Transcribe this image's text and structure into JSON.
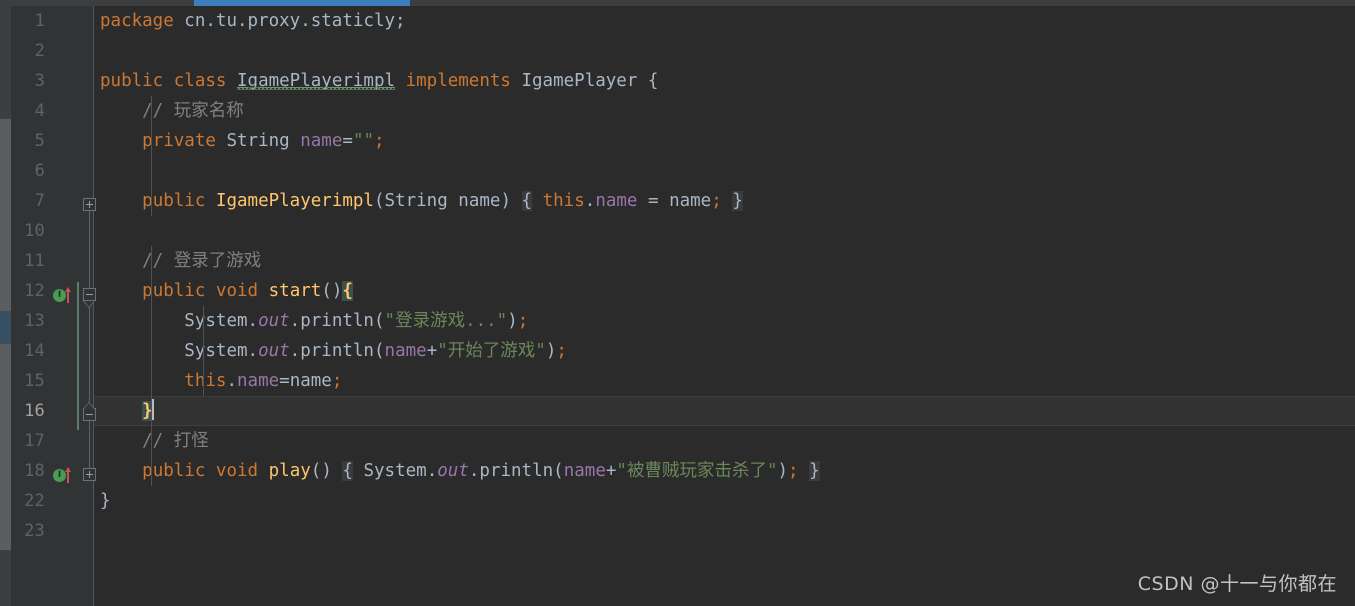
{
  "window": {
    "theme": "darcula",
    "editor_background": "#2b2b2b",
    "gutter_background": "#313335",
    "accent_blue": "#3c7ebd",
    "caret_line_background": "#323232"
  },
  "top_strip": {
    "name": "tab-underline",
    "color": "#3c7ebd"
  },
  "scrollbar": {
    "name": "left-scrollbar",
    "thumb_color": "#5b5d5e",
    "marker_color": "#375063"
  },
  "gutter": {
    "line_numbers": [
      "1",
      "2",
      "3",
      "4",
      "5",
      "6",
      "7",
      "10",
      "11",
      "12",
      "13",
      "14",
      "15",
      "16",
      "17",
      "18",
      "22",
      "23"
    ],
    "caret_line_number": "16",
    "implements_marker_label": "I",
    "markers": [
      {
        "line": "12",
        "type": "implements-method",
        "icon": "green-circle-i-icon",
        "arrow": "red-up-arrow-icon"
      },
      {
        "line": "18",
        "type": "implements-method",
        "icon": "green-circle-i-icon",
        "arrow": "red-up-arrow-icon"
      }
    ],
    "fold_markers": [
      {
        "line": "7",
        "state": "collapsed",
        "glyph": "plus"
      },
      {
        "line": "12",
        "state": "expanded-start",
        "glyph": "minus"
      },
      {
        "line": "16",
        "state": "expanded-end",
        "glyph": "minus"
      },
      {
        "line": "18",
        "state": "collapsed",
        "glyph": "plus"
      }
    ]
  },
  "code": {
    "language": "java",
    "package": "cn.tu.proxy.staticly",
    "class_name": "IgamePlayerimpl",
    "interface_name": "IgamePlayer",
    "lines": [
      {
        "n": "1",
        "text": "package cn.tu.proxy.staticly;"
      },
      {
        "n": "2",
        "text": ""
      },
      {
        "n": "3",
        "text": "public class IgamePlayerimpl implements IgamePlayer {"
      },
      {
        "n": "4",
        "text": "    // 玩家名称"
      },
      {
        "n": "5",
        "text": "    private String name=\"\";"
      },
      {
        "n": "6",
        "text": ""
      },
      {
        "n": "7",
        "text": "    public IgamePlayerimpl(String name) { this.name = name; }"
      },
      {
        "n": "10",
        "text": ""
      },
      {
        "n": "11",
        "text": "    // 登录了游戏"
      },
      {
        "n": "12",
        "text": "    public void start(){"
      },
      {
        "n": "13",
        "text": "        System.out.println(\"登录游戏...\");"
      },
      {
        "n": "14",
        "text": "        System.out.println(name+\"开始了游戏\");"
      },
      {
        "n": "15",
        "text": "        this.name=name;"
      },
      {
        "n": "16",
        "text": "    }"
      },
      {
        "n": "17",
        "text": "    // 打怪"
      },
      {
        "n": "18",
        "text": "    public void play() { System.out.println(name+\"被曹贼玩家击杀了\"); }"
      },
      {
        "n": "22",
        "text": "}"
      },
      {
        "n": "23",
        "text": ""
      }
    ],
    "comments": {
      "player_name": "// 玩家名称",
      "logged_in": "// 登录了游戏",
      "fight": "// 打怪"
    },
    "strings": {
      "empty": "\"\"",
      "login_game": "\"登录游戏...\"",
      "started_game": "\"开始了游戏\"",
      "killed": "\"被曹贼玩家击杀了\""
    },
    "keywords": {
      "package": "package",
      "public": "public",
      "class": "class",
      "implements": "implements",
      "private": "private",
      "void": "void",
      "this": "this"
    },
    "types": {
      "string": "String"
    },
    "methods": {
      "start": "start",
      "play": "play",
      "println": "println"
    },
    "identifiers": {
      "name": "name",
      "system": "System",
      "out": "out"
    },
    "token_colors": {
      "keyword": "#cc7832",
      "string": "#6a8759",
      "comment": "#808080",
      "field": "#9876aa",
      "method": "#ffc66d",
      "plain": "#a9b7c6",
      "brace_match": "#ffc66d"
    }
  },
  "watermark": {
    "text": "CSDN @十一与你都在"
  }
}
